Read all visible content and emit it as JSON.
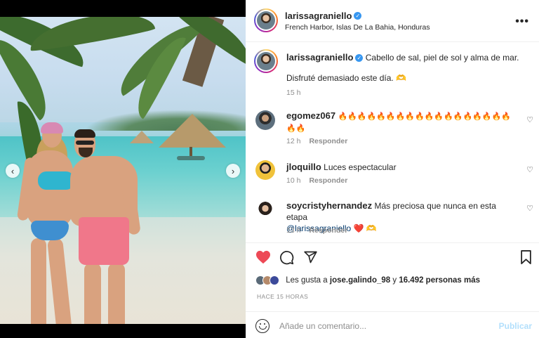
{
  "post": {
    "username": "larissagraniello",
    "location": "French Harbor, Islas De La Bahia, Honduras",
    "caption_line1": "Cabello de sal, piel de sol y alma de mar.",
    "caption_line2": "Disfruté demasiado este día. 🫶",
    "caption_time": "15 h",
    "carousel_count": 6,
    "carousel_active": 1
  },
  "comments": [
    {
      "username": "egomez067",
      "text": "🔥🔥🔥🔥🔥🔥🔥🔥🔥🔥🔥🔥🔥🔥🔥🔥🔥🔥🔥🔥",
      "time": "12 h",
      "reply": "Responder"
    },
    {
      "username": "jloquillo",
      "text": "Luces espectacular",
      "time": "10 h",
      "reply": "Responder"
    },
    {
      "username": "soycristyhernandez",
      "text": "Más preciosa que nunca en esta etapa",
      "mention": "@larissagraniello",
      "after_mention": "❤️ 🫶",
      "time": "13 h",
      "reply": "Responder"
    }
  ],
  "likes": {
    "prefix": "Les gusta a",
    "user": "jose.galindo_98",
    "connector": "y",
    "count": "16.492 personas más"
  },
  "posted_ago": "HACE 15 HORAS",
  "composer": {
    "placeholder": "Añade un comentario...",
    "publish_label": "Publicar"
  },
  "colors": {
    "like_red": "#ed4956",
    "verified_blue": "#3897f0",
    "publish_disabled": "#b2dffc",
    "muted": "#8e8e8e"
  },
  "icons": {
    "like": "heart-filled",
    "comment": "speech-bubble",
    "share": "paper-plane",
    "save": "bookmark",
    "more": "ellipsis",
    "emoji": "smiley",
    "prev": "chevron-left",
    "next": "chevron-right"
  }
}
